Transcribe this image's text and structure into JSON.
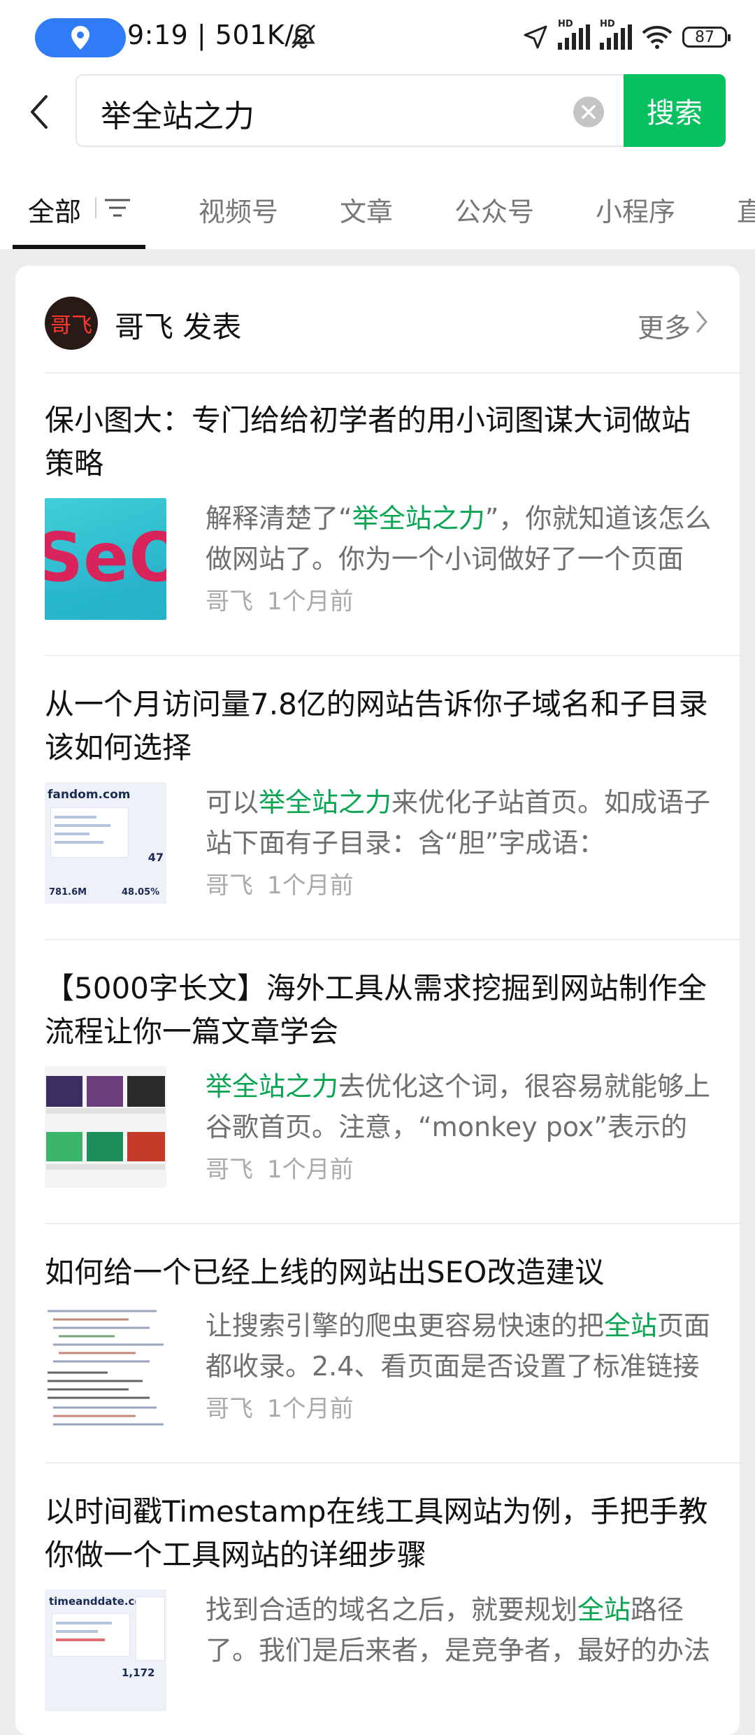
{
  "status_bar": {
    "time_speed": "9:19 | 501K/s",
    "network_type_1": "HD",
    "network_type_2": "HD",
    "battery": "87"
  },
  "search": {
    "query": "举全站之力",
    "button_label": "搜索"
  },
  "tabs": [
    {
      "label": "全部",
      "active": true
    },
    {
      "label": "视频号"
    },
    {
      "label": "文章"
    },
    {
      "label": "公众号"
    },
    {
      "label": "小程序"
    },
    {
      "label": "直"
    }
  ],
  "account": {
    "avatar_text": "哥飞",
    "heading": "哥飞 发表",
    "more_label": "更多"
  },
  "articles": [
    {
      "title": "保小图大：专门给给初学者的用小词图谋大词做站策略",
      "snippet_before": "解释清楚了“",
      "snippet_highlight": "举全站之力",
      "snippet_after": "”，你就知道该怎么做网站了。你为一个小词做好了一个页面",
      "author": "哥飞",
      "time": "1个月前",
      "thumb_text": "SeO"
    },
    {
      "title": "从一个月访问量7.8亿的网站告诉你子域名和子目录该如何选择",
      "snippet_before": "可以",
      "snippet_highlight": "举全站之力",
      "snippet_after": "来优化子站首页。如成语子站下面有子目录：含“胆”字成语：",
      "author": "哥飞",
      "time": "1个月前",
      "thumb_site": "fandom.com",
      "thumb_stat1": "781.6M",
      "thumb_stat2": "48.05%",
      "thumb_stat3": "47"
    },
    {
      "title": "【5000字长文】海外工具从需求挖掘到网站制作全流程让你一篇文章学会",
      "snippet_before": "",
      "snippet_highlight": "举全站之力",
      "snippet_after": "去优化这个词，很容易就能够上谷歌首页。注意，“monkey pox”表示的",
      "author": "哥飞",
      "time": "1个月前"
    },
    {
      "title": "如何给一个已经上线的网站出SEO改造建议",
      "snippet_before": "让搜索引擎的爬虫更容易快速的把",
      "snippet_highlight": "全站",
      "snippet_after": "页面都收录。2.4、看页面是否设置了标准链接",
      "author": "哥飞",
      "time": "1个月前"
    },
    {
      "title": "以时间戳Timestamp在线工具网站为例，手把手教你做一个工具网站的详细步骤",
      "snippet_before": "找到合适的域名之后，就要规划",
      "snippet_highlight": "全站",
      "snippet_after": "路径了。我们是后来者，是竞争者，最好的办法",
      "author": "哥飞",
      "time": "1个月前",
      "thumb_site": "timeanddate.com",
      "thumb_stat1": "1,172"
    }
  ]
}
